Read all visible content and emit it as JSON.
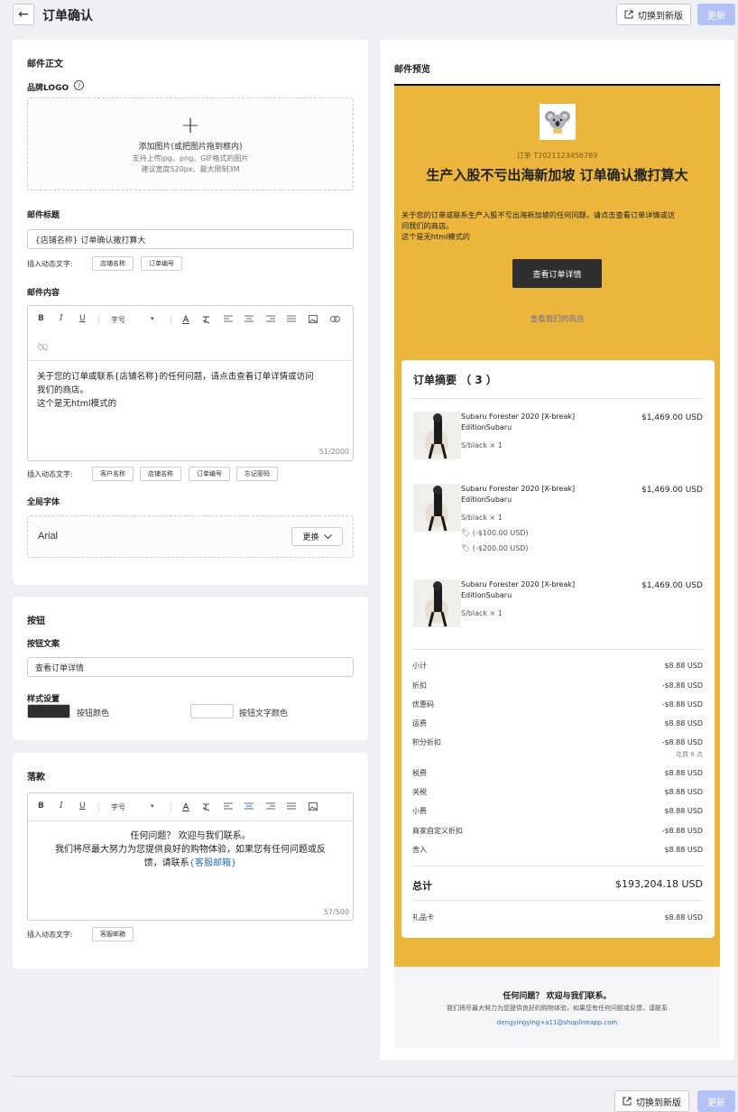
{
  "header": {
    "title": "订单确认",
    "switch_label": "切换到新版",
    "update_label": "更新"
  },
  "body_section": {
    "title": "邮件正文",
    "logo_label": "品牌LOGO",
    "upload": {
      "line1": "添加图片(或把图片拖到框内)",
      "line2": "支持上传jpg、png、GIF格式的图片",
      "line3": "建议宽度520px、最大限制3M"
    },
    "subject_label": "邮件标题",
    "subject_value": "{店铺名称} 订单确认撒打算大",
    "dynamic_label": "插入动态文字:",
    "subject_chips": [
      "店铺名称",
      "订单编号"
    ],
    "content_label": "邮件内容",
    "toolbar": {
      "bold": "B",
      "italic": "I",
      "underline": "U",
      "font_size": "字号",
      "caret": "▾"
    },
    "content_lines": [
      "关于您的订单或联系{店铺名称}的任何问题，请点击查看订单详情或访问",
      "我们的商店。",
      "这个是无html模式的"
    ],
    "content_counter": "51/2000",
    "content_chips": [
      "客户名称",
      "店铺名称",
      "订单编号",
      "忘记密码"
    ],
    "font_label": "全局字体",
    "font_value": "Arial",
    "font_change": "更换"
  },
  "button_section": {
    "title": "按钮",
    "text_label": "按钮文案",
    "text_value": "查看订单详情",
    "style_label": "样式设置",
    "color_label": "按钮颜色",
    "text_color_label": "按钮文字颜色",
    "button_color": "#2f2f2f",
    "text_color": "#ffffff"
  },
  "footer_section": {
    "title": "落款",
    "line1": "任何问题？ 欢迎与我们联系。",
    "line2": "我们将尽最大努力为您提供良好的购物体验，如果您有任何问题或反",
    "line3_prefix": "馈，请联系",
    "line3_link": "{客服邮箱}",
    "counter": "57/500",
    "dynamic_label": "插入动态文字:",
    "chips": [
      "客服邮箱"
    ]
  },
  "preview": {
    "title": "邮件预览",
    "bg_color": "#ecb53b",
    "order_no": "订单 T2021123456789",
    "headline": "生产入股不亏出海新加坡 订单确认撒打算大",
    "body_line1": "关于您的订单或联系生产入股不亏出海新加坡的任何问题，请点击查看订单详情或访",
    "body_line2": "问我们的商店。",
    "body_line3": "这个是无html模式的",
    "cta": "查看订单详情",
    "store_link": "查看我们的商店",
    "summary_title": "订单摘要 （ 3 ）",
    "products": [
      {
        "name1": "Subaru Forester 2020 [X-break]",
        "name2": "EditionSubaru",
        "price": "$1,469.00 USD",
        "variant": "S/black × 1",
        "discounts": []
      },
      {
        "name1": "Subaru Forester 2020 [X-break]",
        "name2": "EditionSubaru",
        "price": "$1,469.00 USD",
        "variant": "S/black × 1",
        "discounts": [
          "(-$100.00 USD)",
          "(-$200.00 USD)"
        ]
      },
      {
        "name1": "Subaru Forester 2020 [X-break]",
        "name2": "EditionSubaru",
        "price": "$1,469.00 USD",
        "variant": "S/black × 1",
        "discounts": []
      }
    ],
    "lines": [
      {
        "k": "小计",
        "v": "$8.88 USD"
      },
      {
        "k": "折扣",
        "v": "-$8.88 USD"
      },
      {
        "k": "优惠码",
        "v": "-$8.88 USD"
      },
      {
        "k": "运费",
        "v": "$8.88 USD"
      },
      {
        "k": "积分折扣",
        "v": "-$8.88 USD",
        "note": "花费 8 点"
      },
      {
        "k": "税费",
        "v": "$8.88 USD"
      },
      {
        "k": "关税",
        "v": "$8.88 USD"
      },
      {
        "k": "小费",
        "v": "$8.88 USD"
      },
      {
        "k": "商家自定义折扣",
        "v": "-$8.88 USD"
      },
      {
        "k": "舍入",
        "v": "$8.88 USD"
      }
    ],
    "total_label": "总计",
    "total_value": "$193,204.18 USD",
    "gift_label": "礼品卡",
    "gift_value": "$8.88 USD",
    "footer_title": "任何问题？ 欢迎与我们联系。",
    "footer_text": "我们将尽最大努力为您提供良好的购物体验，如果您有任何问题或反馈，请联系",
    "footer_email": "dengyingying+a11@shoplineapp.com"
  }
}
